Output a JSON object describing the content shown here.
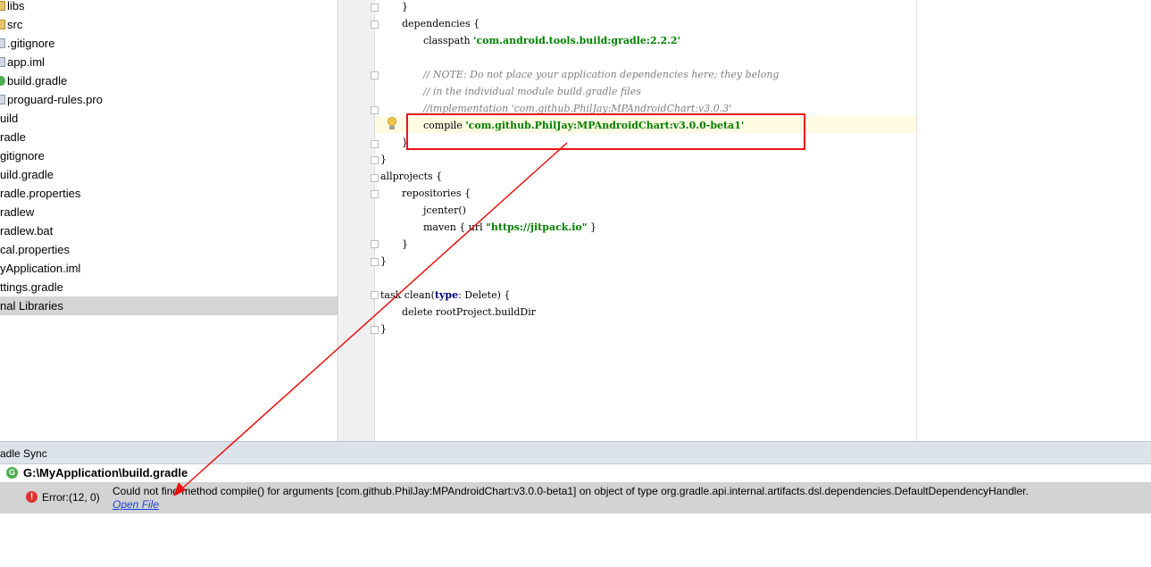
{
  "project_tree": {
    "items": [
      {
        "label": "libs",
        "icon": "folder-icon"
      },
      {
        "label": "src",
        "icon": "folder-icon"
      },
      {
        "label": ".gitignore",
        "icon": "file-icon"
      },
      {
        "label": "app.iml",
        "icon": "file-icon"
      },
      {
        "label": "build.gradle",
        "icon": "gradle-icon"
      },
      {
        "label": "proguard-rules.pro",
        "icon": "file-icon"
      },
      {
        "label": "uild",
        "icon": ""
      },
      {
        "label": "radle",
        "icon": ""
      },
      {
        "label": "gitignore",
        "icon": ""
      },
      {
        "label": "uild.gradle",
        "icon": ""
      },
      {
        "label": "radle.properties",
        "icon": ""
      },
      {
        "label": "radlew",
        "icon": ""
      },
      {
        "label": "radlew.bat",
        "icon": ""
      },
      {
        "label": "cal.properties",
        "icon": ""
      },
      {
        "label": "yApplication.iml",
        "icon": ""
      },
      {
        "label": "ttings.gradle",
        "icon": ""
      },
      {
        "label": "nal Libraries",
        "icon": ""
      }
    ],
    "selected_index": 16
  },
  "editor": {
    "lines": [
      {
        "text": "}",
        "indent": 1,
        "kind": "plain"
      },
      {
        "text": "dependencies {",
        "indent": 1,
        "kind": "plain"
      },
      {
        "pre": "classpath ",
        "str": "'com.android.tools.build:gradle:2.2.2'",
        "indent": 2,
        "kind": "str"
      },
      {
        "text": "",
        "indent": 0,
        "kind": "plain"
      },
      {
        "text": "// NOTE: Do not place your application dependencies here; they belong",
        "indent": 2,
        "kind": "cmt"
      },
      {
        "text": "// in the individual module build.gradle files",
        "indent": 2,
        "kind": "cmt"
      },
      {
        "text": "//implementation 'com.github.PhilJay:MPAndroidChart:v3.0.3'",
        "indent": 2,
        "kind": "cmt"
      },
      {
        "pre": "compile ",
        "str": "'com.github.PhilJay:MPAndroidChart:v3.0.0-beta1'",
        "indent": 2,
        "kind": "str"
      },
      {
        "text": "}",
        "indent": 1,
        "kind": "plain"
      },
      {
        "text": "}",
        "indent": 0,
        "kind": "plain"
      },
      {
        "text": "allprojects {",
        "indent": 0,
        "kind": "plain"
      },
      {
        "text": "repositories {",
        "indent": 1,
        "kind": "plain"
      },
      {
        "text": "jcenter()",
        "indent": 2,
        "kind": "plain"
      },
      {
        "pre": "maven { url ",
        "str": "\"https://jitpack.io\"",
        "post": " }",
        "indent": 2,
        "kind": "str"
      },
      {
        "text": "}",
        "indent": 1,
        "kind": "plain"
      },
      {
        "text": "}",
        "indent": 0,
        "kind": "plain"
      },
      {
        "text": "",
        "indent": 0,
        "kind": "plain"
      },
      {
        "pre": "task clean(",
        "kw": "type",
        "post": ": Delete) {",
        "indent": 0,
        "kind": "kw"
      },
      {
        "text": "delete rootProject.buildDir",
        "indent": 1,
        "kind": "plain"
      },
      {
        "text": "}",
        "indent": 0,
        "kind": "plain"
      }
    ]
  },
  "sync_panel": {
    "title": "adle Sync",
    "file_path": "G:\\MyApplication\\build.gradle",
    "error": {
      "location": "Error:(12, 0)",
      "message": "Could not find method compile() for arguments [com.github.PhilJay:MPAndroidChart:v3.0.0-beta1] on object of type org.gradle.api.internal.artifacts.dsl.dependencies.DefaultDependencyHandler.",
      "link": "Open File"
    }
  },
  "colors": {
    "annotation": "#ee1111",
    "string": "#008000",
    "comment": "#808080",
    "error_icon": "#e0302b",
    "gradle_icon": "#4bae4f",
    "link": "#1a3fd6"
  }
}
